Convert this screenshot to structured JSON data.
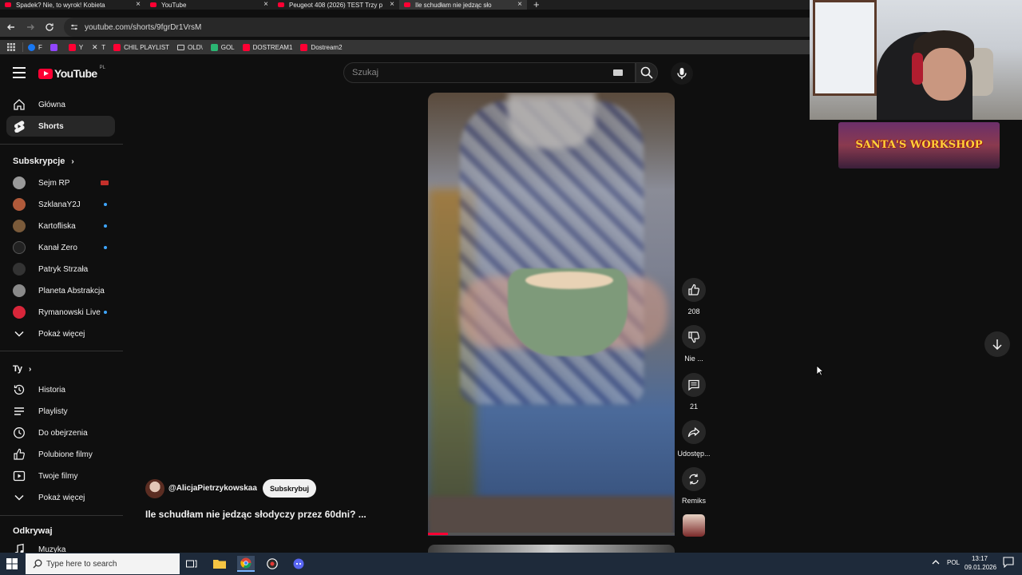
{
  "browser": {
    "tabs": [
      {
        "label": "Spadek? Nie, to wyrok! Kobieta"
      },
      {
        "label": "YouTube"
      },
      {
        "label": "Peugeot 408 (2026) TEST Trzy p"
      },
      {
        "label": "Ile schudłam nie jedząc sło"
      }
    ],
    "new_tab": "+",
    "close_glyph": "×",
    "url": "youtube.com/shorts/9fgrDr1VrsM",
    "bookmarks": [
      {
        "label": "F",
        "color": "#1877f2"
      },
      {
        "label": "",
        "color": "#9146ff"
      },
      {
        "label": "Y",
        "color": "#ff0033"
      },
      {
        "label": "T",
        "color": "#e8e8e8"
      },
      {
        "label": "CHIL PLAYLIST",
        "color": "#ff0033"
      },
      {
        "label": "OLD\\",
        "color": "#cfcfcf"
      },
      {
        "label": "GOL",
        "color": "#2bb673"
      },
      {
        "label": "DOSTREAM1",
        "color": "#ff0033"
      },
      {
        "label": "Dostream2",
        "color": "#ff0033"
      }
    ]
  },
  "youtube": {
    "logo_text": "YouTube",
    "country_code": "PL",
    "search_placeholder": "Szukaj",
    "accent": "#ff0033"
  },
  "sidebar": {
    "main_items": [
      {
        "label": "Główna",
        "icon": "home-icon"
      },
      {
        "label": "Shorts",
        "icon": "shorts-icon"
      }
    ],
    "subs_title": "Subskrypcje",
    "subscriptions": [
      {
        "label": "Sejm RP",
        "avatar_color": "#9a9a9a",
        "marker": "live"
      },
      {
        "label": "SzklanaY2J",
        "avatar_color": "#b05a3a",
        "marker": "dot"
      },
      {
        "label": "Kartofliska",
        "avatar_color": "#7a5a3a",
        "marker": "dot"
      },
      {
        "label": "Kanał Zero",
        "avatar_color": "#222222",
        "marker": "dot"
      },
      {
        "label": "Patryk Strzała",
        "avatar_color": "#333333",
        "marker": ""
      },
      {
        "label": "Planeta Abstrakcja",
        "avatar_color": "#8a8a8a",
        "marker": ""
      },
      {
        "label": "Rymanowski Live",
        "avatar_color": "#d8263a",
        "marker": "dot"
      }
    ],
    "show_more": "Pokaż więcej",
    "you_title": "Ty",
    "you_items": [
      {
        "label": "Historia",
        "icon": "history-icon"
      },
      {
        "label": "Playlisty",
        "icon": "playlist-icon"
      },
      {
        "label": "Do obejrzenia",
        "icon": "clock-icon"
      },
      {
        "label": "Polubione filmy",
        "icon": "thumb-up-icon"
      },
      {
        "label": "Twoje filmy",
        "icon": "video-icon"
      }
    ],
    "show_more_2": "Pokaż więcej",
    "explore_title": "Odkrywaj",
    "explore_items": [
      {
        "label": "Muzyka",
        "icon": "music-icon"
      }
    ]
  },
  "short": {
    "channel": "@AlicjaPietrzykowskaa",
    "subscribe_label": "Subskrybuj",
    "title": "Ile schudłam nie jedząc słodyczy przez 60dni? ...",
    "progress": 0.08,
    "actions": {
      "like_count": "208",
      "dislike_label": "Nie ...",
      "comments_count": "21",
      "share_label": "Udostęp...",
      "remix_label": "Remiks"
    }
  },
  "overlay": {
    "banner_text": "SANTA'S WORKSHOP"
  },
  "taskbar": {
    "search_placeholder": "Type here to search",
    "language": "POL",
    "time": "13:17",
    "date": "09.01.2026"
  }
}
